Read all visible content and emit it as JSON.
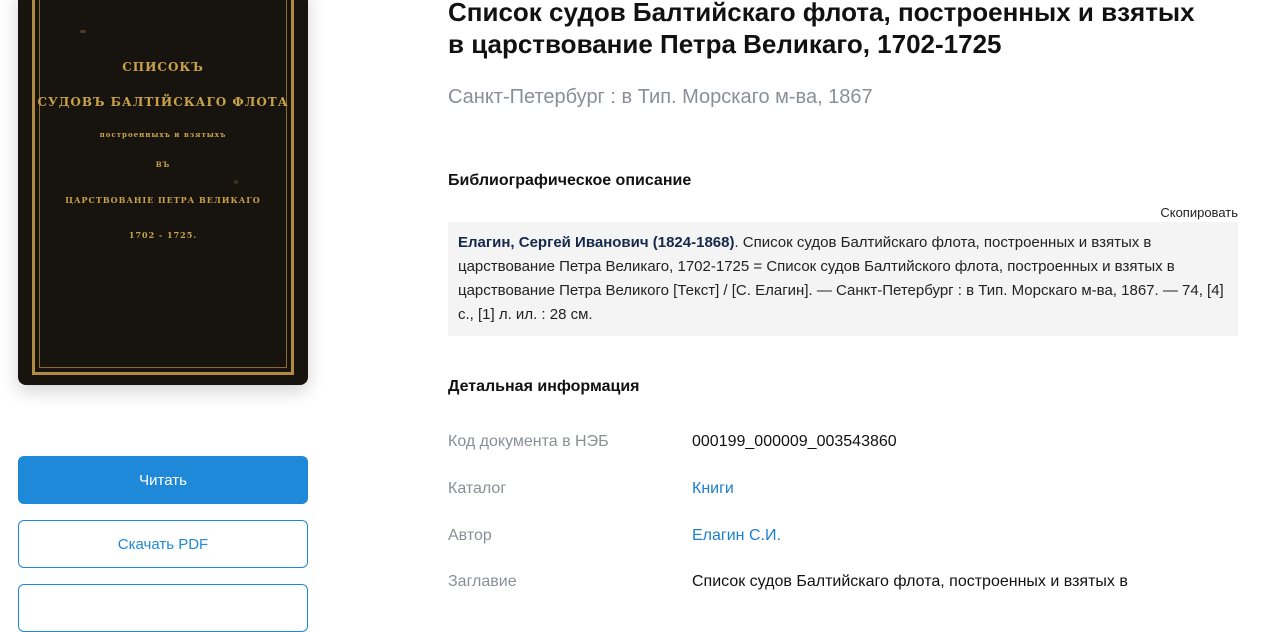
{
  "cover": {
    "line1": "СПИСОКЪ",
    "line2": "СУДОВЪ БАЛТІЙСКАГО ФЛОТА",
    "line3": "построенныхъ и взятыхъ",
    "line4": "ВЪ",
    "line5": "ЦАРСТВОВАНІЕ ПЕТРА ВЕЛИКАГО",
    "line6": "1702 - 1725."
  },
  "actions": {
    "read_label": "Читать",
    "pdf_label": "Скачать PDF"
  },
  "book": {
    "title": "Список судов Балтийскаго флота, построенных и взятых в царствование Петра Великаго, 1702-1725",
    "imprint": "Санкт-Петербург : в Тип. Морскаго м-ва, 1867"
  },
  "biblio": {
    "heading": "Библиографическое описание",
    "copy_label": "Скопировать",
    "author": "Елагин, Сергей Иванович (1824-1868)",
    "text": ". Список судов Балтийскаго флота, построенных и взятых в царствование Петра Великаго, 1702-1725 = Список судов Балтийского флота, построенных и взятых в царствование Петра Великого [Текст] / [С. Елагин]. — Санкт-Петербург : в Тип. Морскаго м-ва, 1867. — 74, [4] с., [1] л. ил. : 28 см."
  },
  "details": {
    "heading": "Детальная информация",
    "rows": [
      {
        "label": "Код документа в НЭБ",
        "value": "000199_000009_003543860"
      },
      {
        "label": "Каталог",
        "value": "Книги"
      },
      {
        "label": "Автор",
        "value": "Елагин С.И."
      },
      {
        "label": "Заглавие",
        "value": "Список судов Балтийскаго флота, построенных и взятых в"
      }
    ]
  },
  "colors": {
    "accent": "#1e88d9",
    "link": "#1c7fcf",
    "muted": "#8a8f96"
  }
}
